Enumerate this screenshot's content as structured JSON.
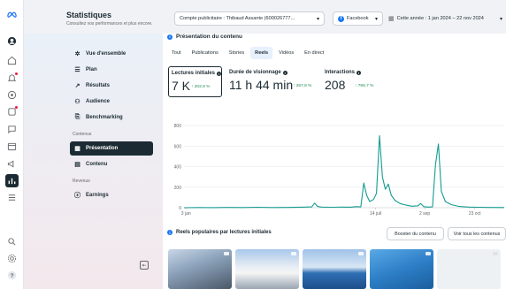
{
  "header": {
    "title": "Statistiques",
    "subtitle": "Consultez vos performances et plus encore.",
    "account_selector": "Compte publicitaire : Thibaud Assante (600026777...",
    "platform_selector": "Facebook",
    "date_selector": "Cette année : 1 jan 2024 – 22 nov 2024"
  },
  "sidebar": {
    "items": [
      {
        "label": "Vue d'ensemble",
        "icon": "sparkle-icon"
      },
      {
        "label": "Plan",
        "icon": "list-icon"
      },
      {
        "label": "Résultats",
        "icon": "trend-icon"
      },
      {
        "label": "Audience",
        "icon": "people-icon"
      },
      {
        "label": "Benchmarking",
        "icon": "compare-icon"
      }
    ],
    "section_contenus": "Contenus",
    "content_items": [
      {
        "label": "Présentation",
        "icon": "grid-icon",
        "active": true
      },
      {
        "label": "Contenu",
        "icon": "table-icon"
      }
    ],
    "section_revenus": "Revenus",
    "revenue_items": [
      {
        "label": "Earnings",
        "icon": "dollar-icon"
      }
    ]
  },
  "main": {
    "section_title": "Présentation du contenu",
    "tabs": [
      "Tout",
      "Publications",
      "Stories",
      "Reels",
      "Vidéos",
      "En direct"
    ],
    "active_tab": "Reels",
    "metrics": [
      {
        "label": "Lectures initiales",
        "value": "7 K",
        "delta": "↑ 202,9 %"
      },
      {
        "label": "Durée de visionnage",
        "value": "11 h 44 min",
        "delta": "↑ 267,8 %"
      },
      {
        "label": "Interactions",
        "value": "208",
        "delta": "↑ 766,7 %"
      }
    ],
    "popular_title": "Reels populaires par lectures initiales",
    "boost_button": "Booster du contenu",
    "see_all_button": "Voir tous les contenus"
  },
  "chart_data": {
    "type": "line",
    "ylim": [
      0,
      800
    ],
    "yticks": [
      "0",
      "200",
      "400",
      "600",
      "800"
    ],
    "xticks": [
      {
        "label": "3 jan",
        "day": 2
      },
      {
        "label": "14 juil",
        "day": 195
      },
      {
        "label": "2 sep",
        "day": 245
      },
      {
        "label": "23 oct",
        "day": 296
      }
    ],
    "xrange": [
      0,
      326
    ],
    "series": [
      {
        "color": "#139c8f",
        "points": [
          [
            0,
            0
          ],
          [
            15,
            2
          ],
          [
            30,
            1
          ],
          [
            45,
            3
          ],
          [
            60,
            2
          ],
          [
            75,
            4
          ],
          [
            90,
            2
          ],
          [
            105,
            3
          ],
          [
            120,
            5
          ],
          [
            130,
            8
          ],
          [
            133,
            45
          ],
          [
            136,
            12
          ],
          [
            140,
            6
          ],
          [
            150,
            4
          ],
          [
            160,
            6
          ],
          [
            170,
            5
          ],
          [
            175,
            10
          ],
          [
            180,
            8
          ],
          [
            183,
            240
          ],
          [
            186,
            120
          ],
          [
            189,
            60
          ],
          [
            193,
            80
          ],
          [
            196,
            140
          ],
          [
            199,
            700
          ],
          [
            202,
            300
          ],
          [
            205,
            180
          ],
          [
            208,
            230
          ],
          [
            211,
            120
          ],
          [
            215,
            70
          ],
          [
            220,
            40
          ],
          [
            226,
            25
          ],
          [
            232,
            15
          ],
          [
            238,
            18
          ],
          [
            241,
            40
          ],
          [
            244,
            10
          ],
          [
            248,
            6
          ],
          [
            253,
            8
          ],
          [
            256,
            420
          ],
          [
            259,
            620
          ],
          [
            262,
            160
          ],
          [
            266,
            60
          ],
          [
            272,
            30
          ],
          [
            280,
            12
          ],
          [
            290,
            6
          ],
          [
            300,
            4
          ],
          [
            310,
            3
          ],
          [
            326,
            2
          ]
        ]
      }
    ]
  }
}
